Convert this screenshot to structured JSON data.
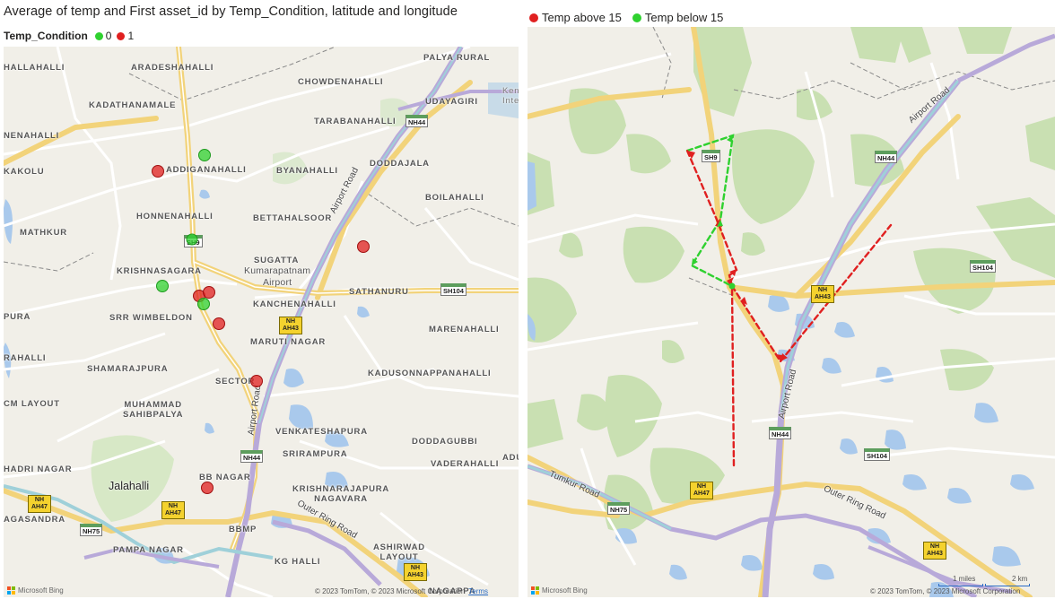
{
  "left_visual": {
    "title": "Average of temp and First asset_id by Temp_Condition, latitude and longitude",
    "legend": {
      "title": "Temp_Condition",
      "items": [
        {
          "label": "0",
          "color": "#2fd12f"
        },
        {
          "label": "1",
          "color": "#e02020"
        }
      ]
    },
    "places": {
      "hallahalli": "HALLAHALLI",
      "aradeshahalli": "ARADESHAHALLI",
      "palya_rural": "PALYA RURAL",
      "chowdenahalli": "CHOWDENAHALLI",
      "kadathanamale": "KADATHANAMALE",
      "udayagiri": "UDAYAGIRI",
      "tarabanahalli": "TARABANAHALLI",
      "nenahalli": "NENAHALLI",
      "kakolu": "KAKOLU",
      "addiganahalli": "ADDIGANAHALLI",
      "byanahalli": "BYANAHALLI",
      "doddajala": "DODDAJALA",
      "boilahalli": "BOILAHALLI",
      "honnenahalli": "HONNENAHALLI",
      "bettahalsoor": "BETTAHALSOOR",
      "mathkur": "MATHKUR",
      "krishnasagara": "KRISHNASAGARA",
      "sugatta": "SUGATTA",
      "kumarapatnam_airport": "Kumarapatnam\nAirport",
      "sathanuru": "SATHANURU",
      "pura": "PURA",
      "srr_wimbeldon": "SRR WIMBELDON",
      "kanchenahalli": "KANCHENAHALLI",
      "marenahalli": "MARENAHALLI",
      "maruti_nagar": "MARUTI NAGAR",
      "rahalli": "RAHALLI",
      "shamarajpura": "SHAMARAJPURA",
      "kadusonnappanahalli": "KADUSONNAPPANAHALLI",
      "sector": "SECTOR",
      "cm_layout": "CM LAYOUT",
      "muhammad_sahibpalya": "MUHAMMAD\nSAHIBPALYA",
      "venkateshapura": "VENKATESHAPURA",
      "doddagubbi": "DODDAGUBBI",
      "srirampura": "SRIRAMPURA",
      "vaderahalli": "VADERAHALLI",
      "adu": "ADU",
      "hadri_nagar": "HADRI NAGAR",
      "bb_nagar": "BB NAGAR",
      "jalahalli": "Jalahalli",
      "krishnarajapura_nagavara": "KRISHNARAJAPURA\nNAGAVARA",
      "agasandra": "AGASANDRA",
      "bbmp": "BBMP",
      "pampa_nagar": "PAMPA NAGAR",
      "ashirwad_layout": "ASHIRWAD\nLAYOUT",
      "kg_halli": "KG HALLI",
      "nagappa": "NAGAPPA",
      "ken_inte": "Ken\nInte",
      "airport_road": "Airport Road",
      "outer_ring_road": "Outer Ring Road"
    },
    "shields": {
      "nh44_top": "NH44",
      "sh9": "SH9",
      "sh104": "SH104",
      "ah43": "NH\nAH43",
      "nh44_bottom": "NH44",
      "ah47_left": "NH\nAH47",
      "ah47_mid": "NH\nAH47",
      "nh75": "NH75",
      "ah43_bottom": "NH\nAH43"
    },
    "points": [
      {
        "condition": "0",
        "color": "#2fd12f"
      },
      {
        "condition": "1",
        "color": "#e02020"
      },
      {
        "condition": "1",
        "color": "#e02020"
      },
      {
        "condition": "0",
        "color": "#2fd12f"
      },
      {
        "condition": "0",
        "color": "#2fd12f"
      },
      {
        "condition": "1",
        "color": "#e02020"
      },
      {
        "condition": "1",
        "color": "#e02020"
      },
      {
        "condition": "0",
        "color": "#2fd12f"
      },
      {
        "condition": "1",
        "color": "#e02020"
      },
      {
        "condition": "1",
        "color": "#e02020"
      },
      {
        "condition": "1",
        "color": "#e02020"
      }
    ],
    "attribution": "© 2023 TomTom, © 2023 Microsoft Corporation",
    "terms": "Terms",
    "logo": "Microsoft Bing"
  },
  "right_visual": {
    "legend": {
      "items": [
        {
          "label": "Temp above 15",
          "color": "#e02020"
        },
        {
          "label": "Temp below 15",
          "color": "#2fd12f"
        }
      ]
    },
    "places": {
      "airport_road_top": "Airport Road",
      "airport_road_mid": "Airport Road",
      "tumkur_road": "Tumkur Road",
      "outer_ring_road": "Outer Ring Road"
    },
    "shields": {
      "sh9": "SH9",
      "nh44_top": "NH44",
      "sh104": "SH104",
      "ah43": "NH\nAH43",
      "nh44_mid": "NH44",
      "sh104_bottom": "SH104",
      "ah47": "NH\nAH47",
      "nh75": "NH75",
      "ah43_bottom": "NH\nAH43"
    },
    "routes": [
      {
        "name": "Temp above 15",
        "color": "#e02020"
      },
      {
        "name": "Temp below 15",
        "color": "#2fd12f"
      }
    ],
    "scale": {
      "miles": "1 miles",
      "km": "2 km"
    },
    "attribution": "© 2023 TomTom, © 2023 Microsoft Corporation",
    "logo": "Microsoft Bing"
  }
}
